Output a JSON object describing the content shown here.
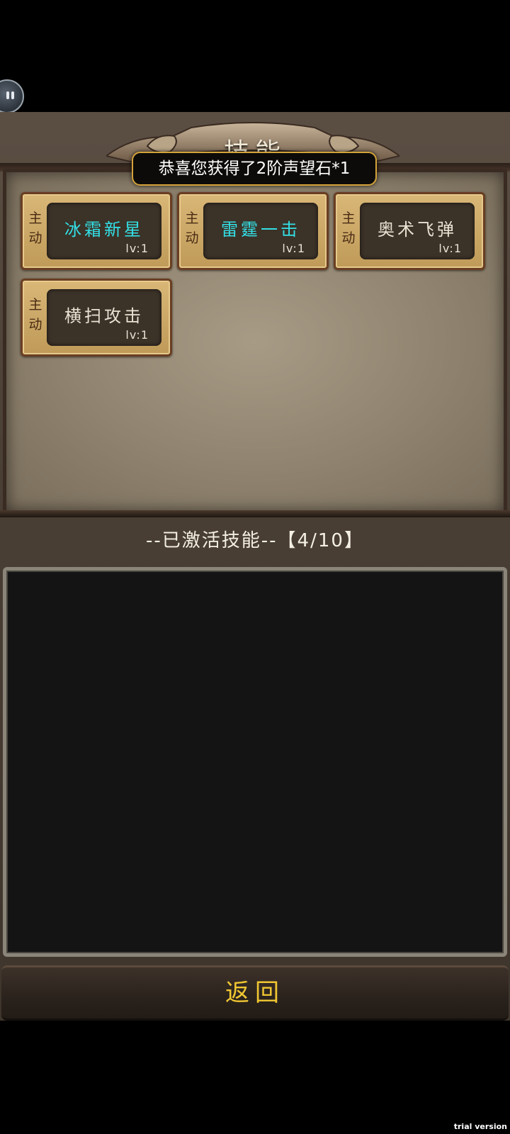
{
  "header": {
    "title": "技能"
  },
  "toast": {
    "message": "恭喜您获得了2阶声望石*1"
  },
  "skills": [
    {
      "type": "主\n动",
      "name": "冰霜新星",
      "level": "lv:1",
      "color": "#33e0e6"
    },
    {
      "type": "主\n动",
      "name": "雷霆一击",
      "level": "lv:1",
      "color": "#33e0e6"
    },
    {
      "type": "主\n动",
      "name": "奥术飞弹",
      "level": "lv:1",
      "color": "#e9e2d2"
    },
    {
      "type": "主\n动",
      "name": "横扫攻击",
      "level": "lv:1",
      "color": "#e9e2d2"
    }
  ],
  "active": {
    "header": "--已激活技能--【4/10】"
  },
  "footer": {
    "return_label": "返回"
  },
  "watermark": "trial version"
}
